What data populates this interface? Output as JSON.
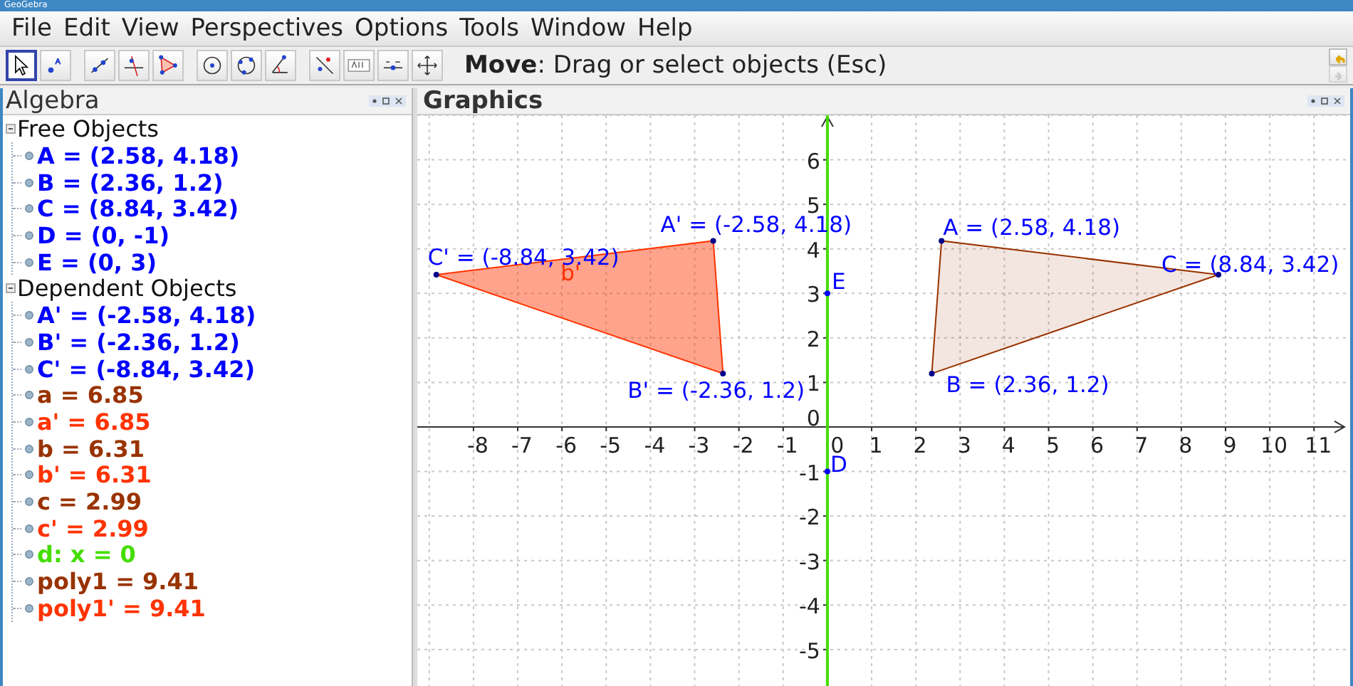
{
  "window": {
    "title": "GeoGebra"
  },
  "menu": [
    "File",
    "Edit",
    "View",
    "Perspectives",
    "Options",
    "Tools",
    "Window",
    "Help"
  ],
  "toolbar": {
    "tools": [
      {
        "selected": true
      },
      {
        "selected": false
      },
      {
        "selected": false
      },
      {
        "selected": false
      },
      {
        "selected": false
      },
      {
        "selected": false
      },
      {
        "selected": false
      },
      {
        "selected": false
      },
      {
        "selected": false
      },
      {
        "selected": false
      },
      {
        "selected": false
      },
      {
        "selected": false
      }
    ],
    "help": "**Move**: Drag or select objects (Esc)",
    "undo": {
      "disabled": false
    },
    "redo": {
      "disabled": true
    }
  },
  "algebra": {
    "title": "Algebra",
    "groups": [
      {
        "label": "Free Objects",
        "expanded": true,
        "children": [
          {
            "text": "A = (2.58, 4.18)",
            "color": "#0000ff"
          },
          {
            "text": "B = (2.36, 1.2)",
            "color": "#0000ff"
          },
          {
            "text": "C = (8.84, 3.42)",
            "color": "#0000ff"
          },
          {
            "text": "D = (0, -1)",
            "color": "#0000ff"
          },
          {
            "text": "E = (0, 3)",
            "color": "#0000ff"
          }
        ]
      },
      {
        "label": "Dependent Objects",
        "expanded": true,
        "children": [
          {
            "text": "A' = (-2.58, 4.18)",
            "color": "#0000ff"
          },
          {
            "text": "B' = (-2.36, 1.2)",
            "color": "#0000ff"
          },
          {
            "text": "C' = (-8.84, 3.42)",
            "color": "#0000ff"
          },
          {
            "text": "a = 6.85",
            "color": "#993300"
          },
          {
            "text": "a' = 6.85",
            "color": "#ff3300"
          },
          {
            "text": "b = 6.31",
            "color": "#993300"
          },
          {
            "text": "b' = 6.31",
            "color": "#ff3300"
          },
          {
            "text": "c = 2.99",
            "color": "#993300"
          },
          {
            "text": "c' = 2.99",
            "color": "#ff3300"
          },
          {
            "text": "d: x = 0",
            "color": "#44dd00"
          },
          {
            "text": "poly1 = 9.41",
            "color": "#993300"
          },
          {
            "text": "poly1' = 9.41",
            "color": "#ff3300"
          }
        ]
      }
    ]
  },
  "graphics": {
    "title": "Graphics",
    "x_axis_labels": [
      "-8",
      "-7",
      "-6",
      "-5",
      "-4",
      "-3",
      "-2",
      "-1",
      "0",
      "1",
      "2",
      "3",
      "4",
      "5",
      "6",
      "7",
      "8",
      "9",
      "10",
      "11"
    ],
    "y_axis_labels": [
      "6",
      "5",
      "4",
      "3",
      "2",
      "1",
      "0",
      "-1",
      "-2",
      "-3",
      "-4",
      "-5"
    ],
    "shapes": [
      {
        "kind": "polygon",
        "color": "#993300"
      },
      {
        "kind": "polygon",
        "color": "#ff3300"
      },
      {
        "kind": "line",
        "color": "#44dd00"
      },
      {
        "kind": "point",
        "color": "#0000ff"
      },
      {
        "kind": "point",
        "color": "#0000ff"
      }
    ],
    "labels": [
      {
        "text": "A = (2.58, 4.18)",
        "color": "#0000ff"
      },
      {
        "text": "B = (2.36, 1.2)",
        "color": "#0000ff"
      },
      {
        "text": "C = (8.84, 3.42)",
        "color": "#0000ff"
      },
      {
        "text": "A' = (-2.58, 4.18)",
        "color": "#0000ff"
      },
      {
        "text": "B' = (-2.36, 1.2)",
        "color": "#0000ff"
      },
      {
        "text": "b'",
        "color": "#ff3300"
      },
      {
        "text": "C' = (-8.84, 3.42)",
        "color": "#0000ff"
      },
      {
        "text": "E",
        "color": "#0000ff"
      },
      {
        "text": "D",
        "color": "#0000ff"
      }
    ]
  }
}
